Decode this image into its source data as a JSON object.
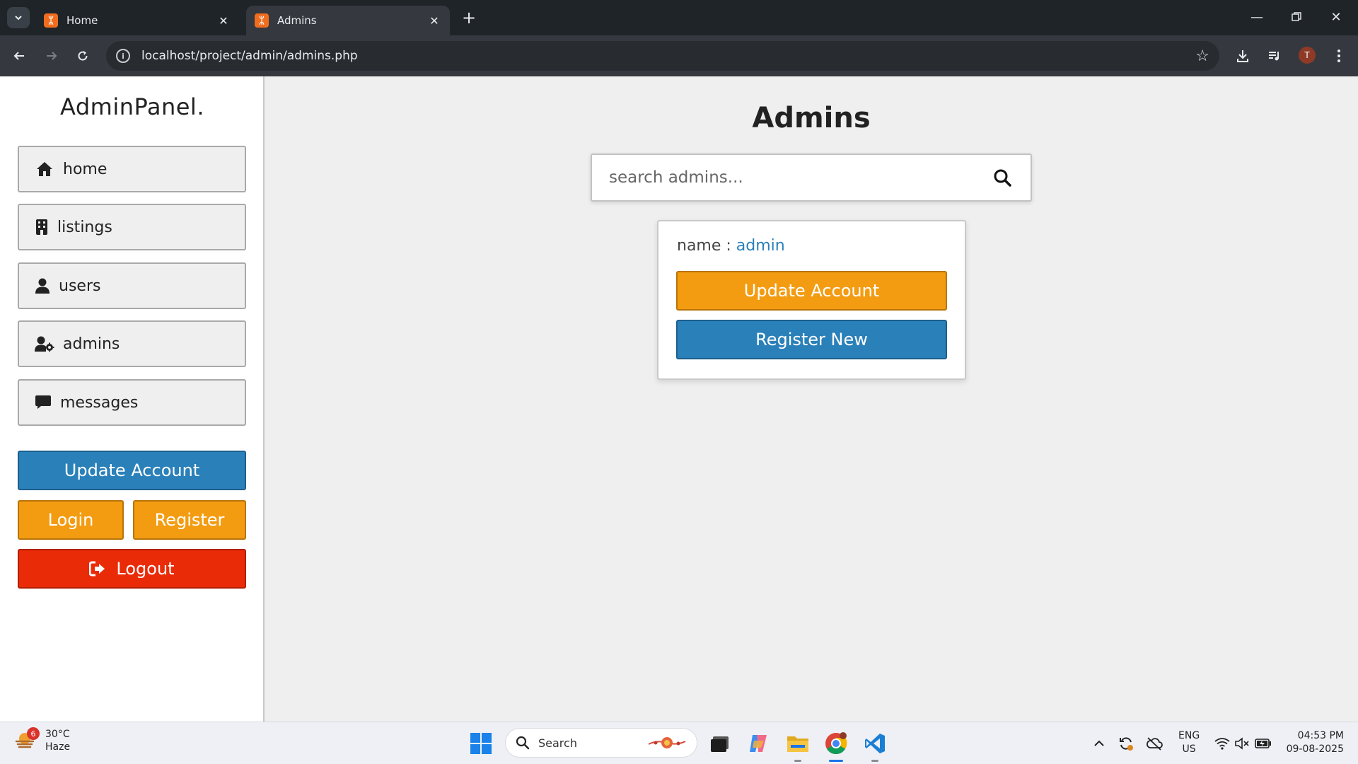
{
  "browser": {
    "tabs": [
      {
        "title": "Home",
        "favicon": "xampp-icon"
      },
      {
        "title": "Admins",
        "favicon": "xampp-icon"
      }
    ],
    "url": "localhost/project/admin/admins.php"
  },
  "sidebar": {
    "brand": "AdminPanel.",
    "nav": [
      {
        "label": "home",
        "icon": "house-icon"
      },
      {
        "label": "listings",
        "icon": "building-icon"
      },
      {
        "label": "users",
        "icon": "user-icon"
      },
      {
        "label": "admins",
        "icon": "user-gear-icon"
      },
      {
        "label": "messages",
        "icon": "comment-icon"
      }
    ],
    "update_account": "Update Account",
    "login": "Login",
    "register": "Register",
    "logout": "Logout"
  },
  "main": {
    "title": "Admins",
    "search_placeholder": "search admins...",
    "card": {
      "name_label": "name : ",
      "name_value": "admin",
      "update_button": "Update Account",
      "register_button": "Register New"
    }
  },
  "colors": {
    "blue": "#2a80b9",
    "orange": "#f39c12",
    "red": "#ea2b08"
  },
  "taskbar": {
    "weather_temp": "30°C",
    "weather_desc": "Haze",
    "weather_badge": "6",
    "search_label": "Search",
    "lang_line1": "ENG",
    "lang_line2": "US",
    "time": "04:53 PM",
    "date": "09-08-2025"
  }
}
